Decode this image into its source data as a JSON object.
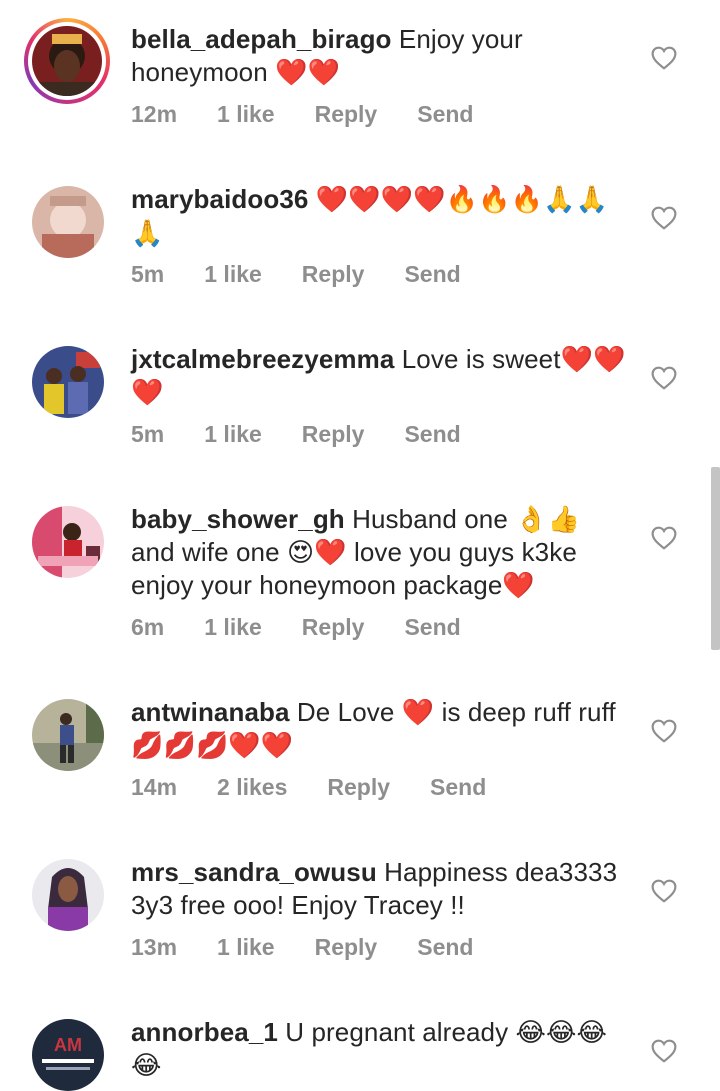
{
  "comments": [
    {
      "username": "bella_adepah_birago",
      "text": "Enjoy your honeymoon ❤️❤️",
      "time": "12m",
      "likes": "1 like",
      "reply": "Reply",
      "send": "Send",
      "avatar_colors": [
        "#7a1f1f",
        "#2b1a12",
        "#e9b14b"
      ],
      "has_story": true
    },
    {
      "username": "marybaidoo36",
      "text": "❤️❤️❤️❤️🔥🔥🔥🙏🙏🙏",
      "time": "5m",
      "likes": "1 like",
      "reply": "Reply",
      "send": "Send",
      "avatar_colors": [
        "#d9b6a8",
        "#f2d9d0",
        "#b86a5b"
      ],
      "has_story": false
    },
    {
      "username": "jxtcalmebreezyemma",
      "text": "Love is sweet❤️❤️❤️",
      "time": "5m",
      "likes": "1 like",
      "reply": "Reply",
      "send": "Send",
      "avatar_colors": [
        "#3a4c8a",
        "#e3c72a",
        "#c9403b"
      ],
      "has_story": false
    },
    {
      "username": "baby_shower_gh",
      "text": "Husband one 👌👍 and wife one 😍❤️ love you guys k3ke enjoy your honeymoon package❤️",
      "time": "6m",
      "likes": "1 like",
      "reply": "Reply",
      "send": "Send",
      "avatar_colors": [
        "#d94a6f",
        "#f6d1dc",
        "#6a2b3a"
      ],
      "has_story": false
    },
    {
      "username": "antwinanaba",
      "text": "De Love ❤️ is deep ruff ruff💋💋💋❤️❤️",
      "time": "14m",
      "likes": "2 likes",
      "reply": "Reply",
      "send": "Send",
      "avatar_colors": [
        "#8c8f7a",
        "#5c6b4a",
        "#b7b39a"
      ],
      "has_story": false
    },
    {
      "username": "mrs_sandra_owusu",
      "text": "Happiness dea3333 3y3 free ooo! Enjoy Tracey !!",
      "time": "13m",
      "likes": "1 like",
      "reply": "Reply",
      "send": "Send",
      "avatar_colors": [
        "#e9e9ee",
        "#3b2a3e",
        "#8a3aa6"
      ],
      "has_story": false
    },
    {
      "username": "annorbea_1",
      "text": "U pregnant already 😂😂😂😂",
      "time": "",
      "likes": "",
      "reply": "",
      "send": "",
      "avatar_colors": [
        "#1f2a3c",
        "#c9363f",
        "#ffffff"
      ],
      "has_story": false
    }
  ]
}
